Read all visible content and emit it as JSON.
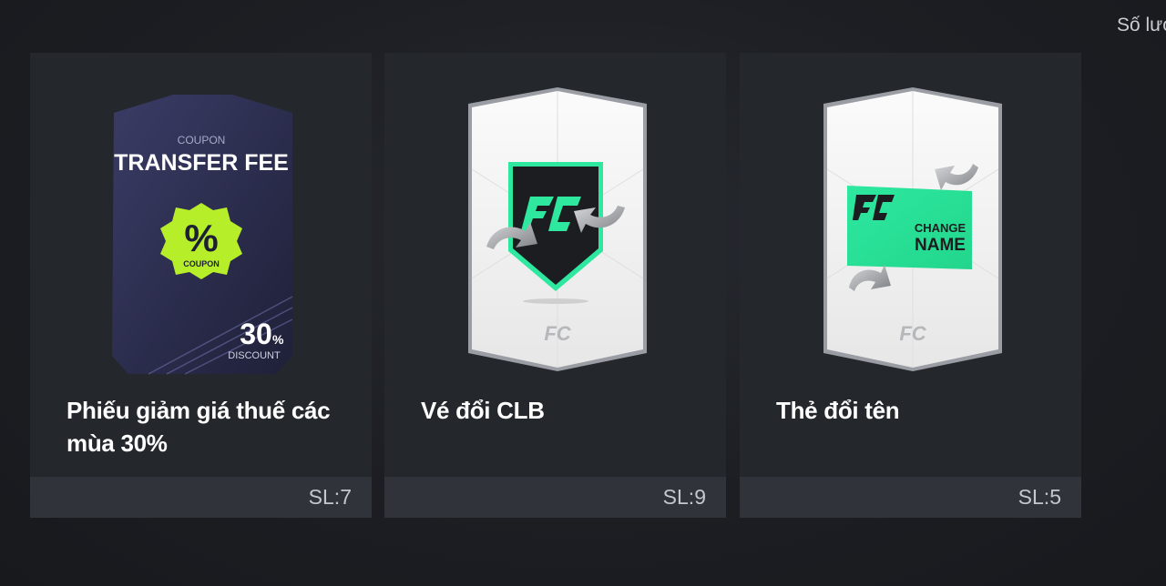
{
  "header": {
    "quantity_label": "Số lượ"
  },
  "items": [
    {
      "name": "Phiếu giảm giá thuế các mùa 30%",
      "quantity": "SL:7",
      "icon": "transfer-fee-coupon-card",
      "art": {
        "coupon_label": "COUPON",
        "title": "TRANSFER FEE",
        "badge_symbol": "%",
        "badge_label": "COUPON",
        "discount_value": "30",
        "discount_unit": "%",
        "discount_label": "DISCOUNT"
      }
    },
    {
      "name": "Vé đổi CLB",
      "quantity": "SL:9",
      "icon": "club-change-ticket-card"
    },
    {
      "name": "Thẻ đổi tên",
      "quantity": "SL:5",
      "icon": "name-change-card",
      "art": {
        "line1": "CHANGE",
        "line2": "NAME"
      }
    }
  ],
  "colors": {
    "accent_green": "#2ee8a0",
    "coupon_badge": "#b7ee2a",
    "coupon_card": "#2a2b4c",
    "card_background": "#24272c",
    "card_footer": "#30333a"
  }
}
